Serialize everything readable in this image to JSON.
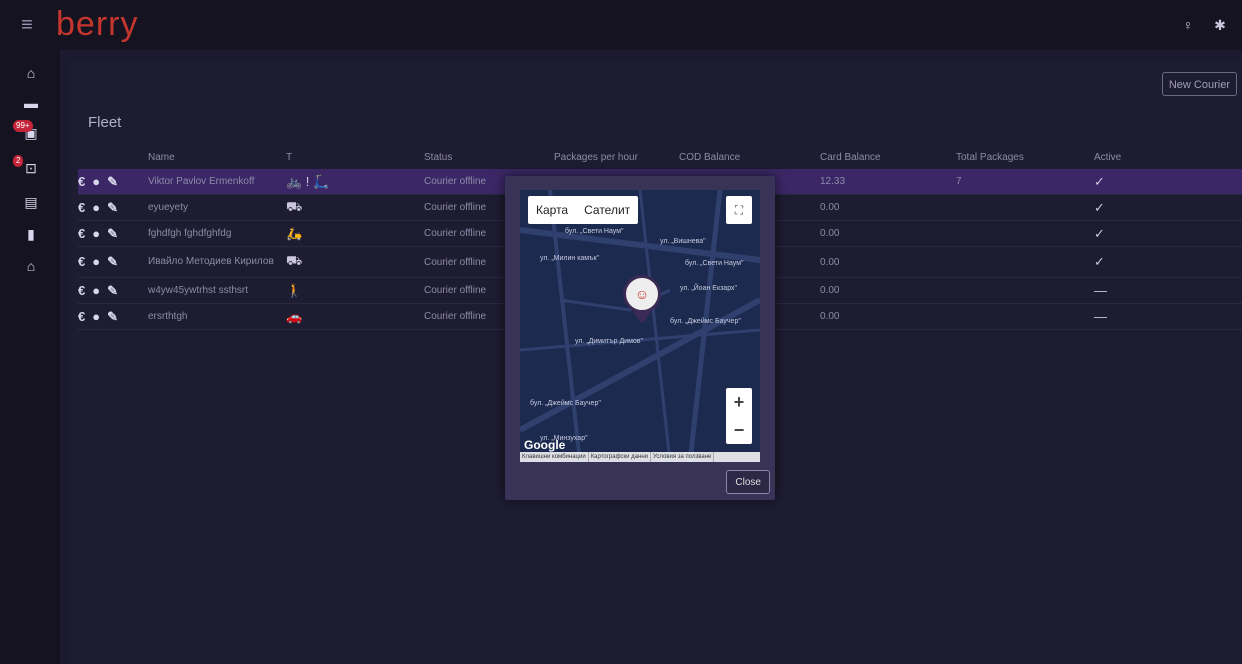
{
  "app": {
    "logo": "berry",
    "menu_icon": "menu-icon"
  },
  "top_icons": [
    "bulb-icon",
    "gear-icon"
  ],
  "sidebar": {
    "items": [
      {
        "name": "home-icon",
        "glyph": "⌂"
      },
      {
        "name": "truck-icon",
        "glyph": "▬"
      },
      {
        "name": "package-icon",
        "glyph": "▣",
        "badge": "99+"
      },
      {
        "name": "inbox-icon",
        "glyph": "⊡",
        "badge": "2"
      },
      {
        "name": "store-icon",
        "glyph": "▤"
      },
      {
        "name": "document-icon",
        "glyph": "▮"
      },
      {
        "name": "bank-icon",
        "glyph": "⌂"
      }
    ]
  },
  "main": {
    "new_courier_label": "New Courier",
    "title": "Fleet",
    "columns": [
      "Name",
      "T",
      "Status",
      "Packages per hour",
      "COD Balance",
      "Card Balance",
      "Total Packages",
      "Active"
    ],
    "rows": [
      {
        "name": "Viktor Pavlov Ermenkoff",
        "type_icon": "🚲 ! 🛴",
        "status": "Courier offline",
        "packages_per_hour": "",
        "cod_balance": "",
        "card_balance": "12.33",
        "total_packages": "7",
        "active": "✓",
        "selected": true
      },
      {
        "name": "eyueyety",
        "type_icon": "⛟",
        "status": "Courier offline",
        "packages_per_hour": "",
        "cod_balance": "",
        "card_balance": "0.00",
        "total_packages": "",
        "active": "✓"
      },
      {
        "name": "fghdfgh fghdfghfdg",
        "type_icon": "🛵",
        "status": "Courier offline",
        "packages_per_hour": "",
        "cod_balance": "",
        "card_balance": "0.00",
        "total_packages": "",
        "active": "✓"
      },
      {
        "name": "Ивайло Методиев Кирилов",
        "type_icon": "⛟",
        "status": "Courier offline",
        "packages_per_hour": "",
        "cod_balance": "",
        "card_balance": "0.00",
        "total_packages": "",
        "active": "✓"
      },
      {
        "name": "w4yw45ywtrhst ssthsrt",
        "type_icon": "🚶",
        "status": "Courier offline",
        "packages_per_hour": "",
        "cod_balance": "",
        "card_balance": "0.00",
        "total_packages": "",
        "active": "—"
      },
      {
        "name": "ersrthtgh",
        "type_icon": "🚗",
        "status": "Courier offline",
        "packages_per_hour": "",
        "cod_balance": "",
        "card_balance": "0.00",
        "total_packages": "",
        "active": "—"
      }
    ]
  },
  "modal": {
    "map_tab": "Карта",
    "satellite_tab": "Сателит",
    "streets": [
      "бул. „Свети Наум\"",
      "ул. „Вишнева\"",
      "бул. „Свети Наум\"",
      "ул. „Йоан Екзарх\"",
      "бул. „Джеймс Баучер\"",
      "ул. „Димитър Димов\"",
      "бул. „Джеймс Баучер\"",
      "ул. „Милин камък\"",
      "ул. „Минзухар\""
    ],
    "google": "Google",
    "footer": [
      "Клавишни комбинации",
      "Картографски данни",
      "Условия за ползване"
    ],
    "close_label": "Close"
  }
}
